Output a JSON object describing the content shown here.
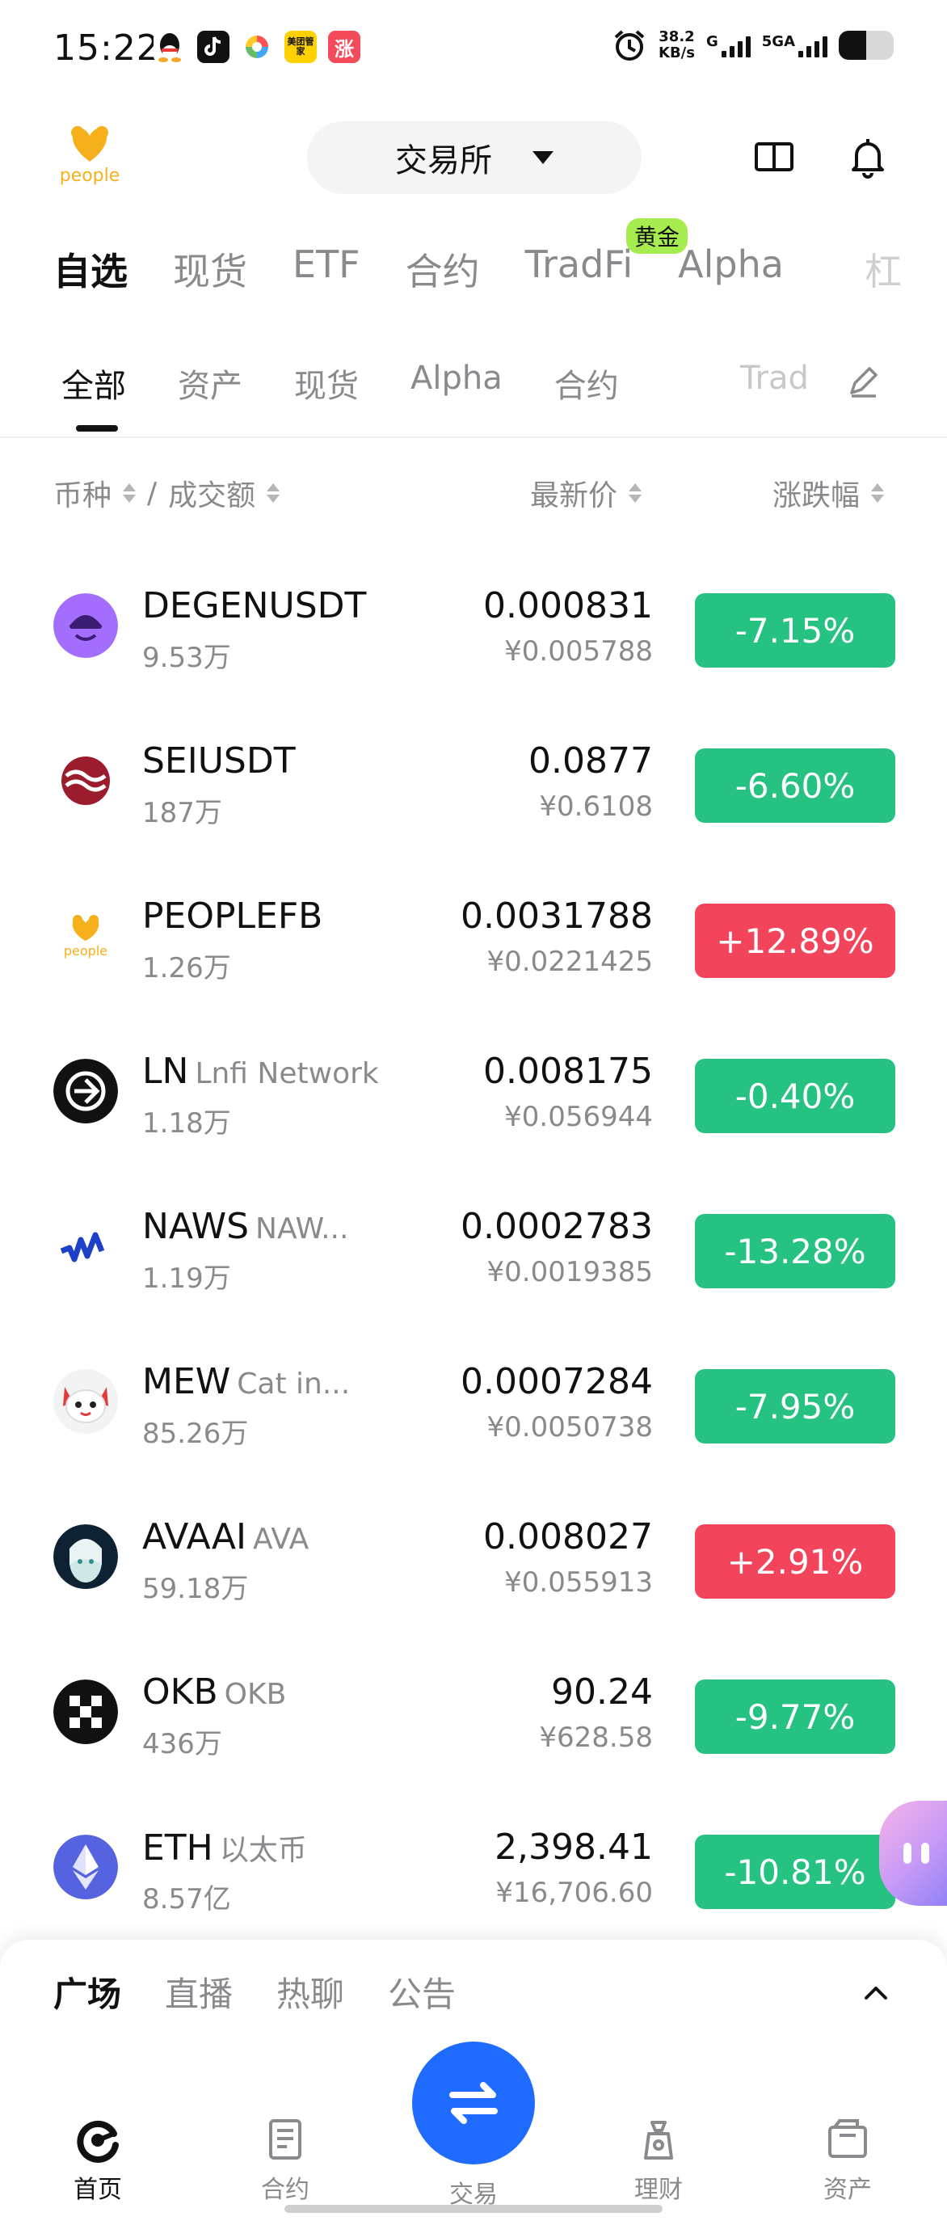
{
  "status_bar": {
    "time": "15:22",
    "net_speed_value": "38.2",
    "net_speed_unit": "KB/s",
    "net_type_1": "G",
    "net_type_2": "5GA",
    "app_badge_meituan": "美团管家",
    "app_badge_zhang": "涨"
  },
  "header": {
    "logo_text": "people",
    "exchange_label": "交易所"
  },
  "main_tabs": [
    {
      "label": "自选",
      "active": true
    },
    {
      "label": "现货"
    },
    {
      "label": "ETF"
    },
    {
      "label": "合约"
    },
    {
      "label": "TradFi"
    },
    {
      "label": "Alpha"
    }
  ],
  "main_tabs_badge": "黄金",
  "main_tabs_overflow": "杠",
  "sub_tabs": [
    {
      "label": "全部",
      "active": true
    },
    {
      "label": "资产"
    },
    {
      "label": "现货"
    },
    {
      "label": "Alpha"
    },
    {
      "label": "合约"
    }
  ],
  "sub_tabs_overflow": "Trad",
  "columns": {
    "coin": "币种",
    "separator": "/",
    "volume": "成交额",
    "price": "最新价",
    "change": "涨跌幅"
  },
  "rows": [
    {
      "symbol": "DEGENUSDT",
      "name": "",
      "volume": "9.53万",
      "price": "0.000831",
      "price_cny": "¥0.005788",
      "change": "-7.15%",
      "dir": "down",
      "icon": "degen-icon"
    },
    {
      "symbol": "SEIUSDT",
      "name": "",
      "volume": "187万",
      "price": "0.0877",
      "price_cny": "¥0.6108",
      "change": "-6.60%",
      "dir": "down",
      "icon": "sei-icon"
    },
    {
      "symbol": "PEOPLEFB",
      "name": "",
      "volume": "1.26万",
      "price": "0.0031788",
      "price_cny": "¥0.0221425",
      "change": "+12.89%",
      "dir": "up",
      "icon": "people-icon"
    },
    {
      "symbol": "LN",
      "name": "Lnfi Network",
      "volume": "1.18万",
      "price": "0.008175",
      "price_cny": "¥0.056944",
      "change": "-0.40%",
      "dir": "down",
      "icon": "ln-icon"
    },
    {
      "symbol": "NAWS",
      "name": "NAW...",
      "volume": "1.19万",
      "price": "0.0002783",
      "price_cny": "¥0.0019385",
      "change": "-13.28%",
      "dir": "down",
      "icon": "naws-icon"
    },
    {
      "symbol": "MEW",
      "name": "Cat in...",
      "volume": "85.26万",
      "price": "0.0007284",
      "price_cny": "¥0.0050738",
      "change": "-7.95%",
      "dir": "down",
      "icon": "mew-icon"
    },
    {
      "symbol": "AVAAI",
      "name": "AVA",
      "volume": "59.18万",
      "price": "0.008027",
      "price_cny": "¥0.055913",
      "change": "+2.91%",
      "dir": "up",
      "icon": "avaai-icon"
    },
    {
      "symbol": "OKB",
      "name": "OKB",
      "volume": "436万",
      "price": "90.24",
      "price_cny": "¥628.58",
      "change": "-9.77%",
      "dir": "down",
      "icon": "okb-icon"
    },
    {
      "symbol": "ETH",
      "name": "以太币",
      "volume": "8.57亿",
      "price": "2,398.41",
      "price_cny": "¥16,706.60",
      "change": "-10.81%",
      "dir": "down",
      "icon": "eth-icon"
    }
  ],
  "feed_tabs": [
    {
      "label": "广场",
      "active": true
    },
    {
      "label": "直播"
    },
    {
      "label": "热聊"
    },
    {
      "label": "公告"
    }
  ],
  "nav": {
    "home": "首页",
    "futures": "合约",
    "trade": "交易",
    "earn": "理财",
    "assets": "资产"
  },
  "colors": {
    "up": "#f2455b",
    "down": "#26c281",
    "accent": "#1f6bff",
    "badge": "#a6ec4e"
  }
}
